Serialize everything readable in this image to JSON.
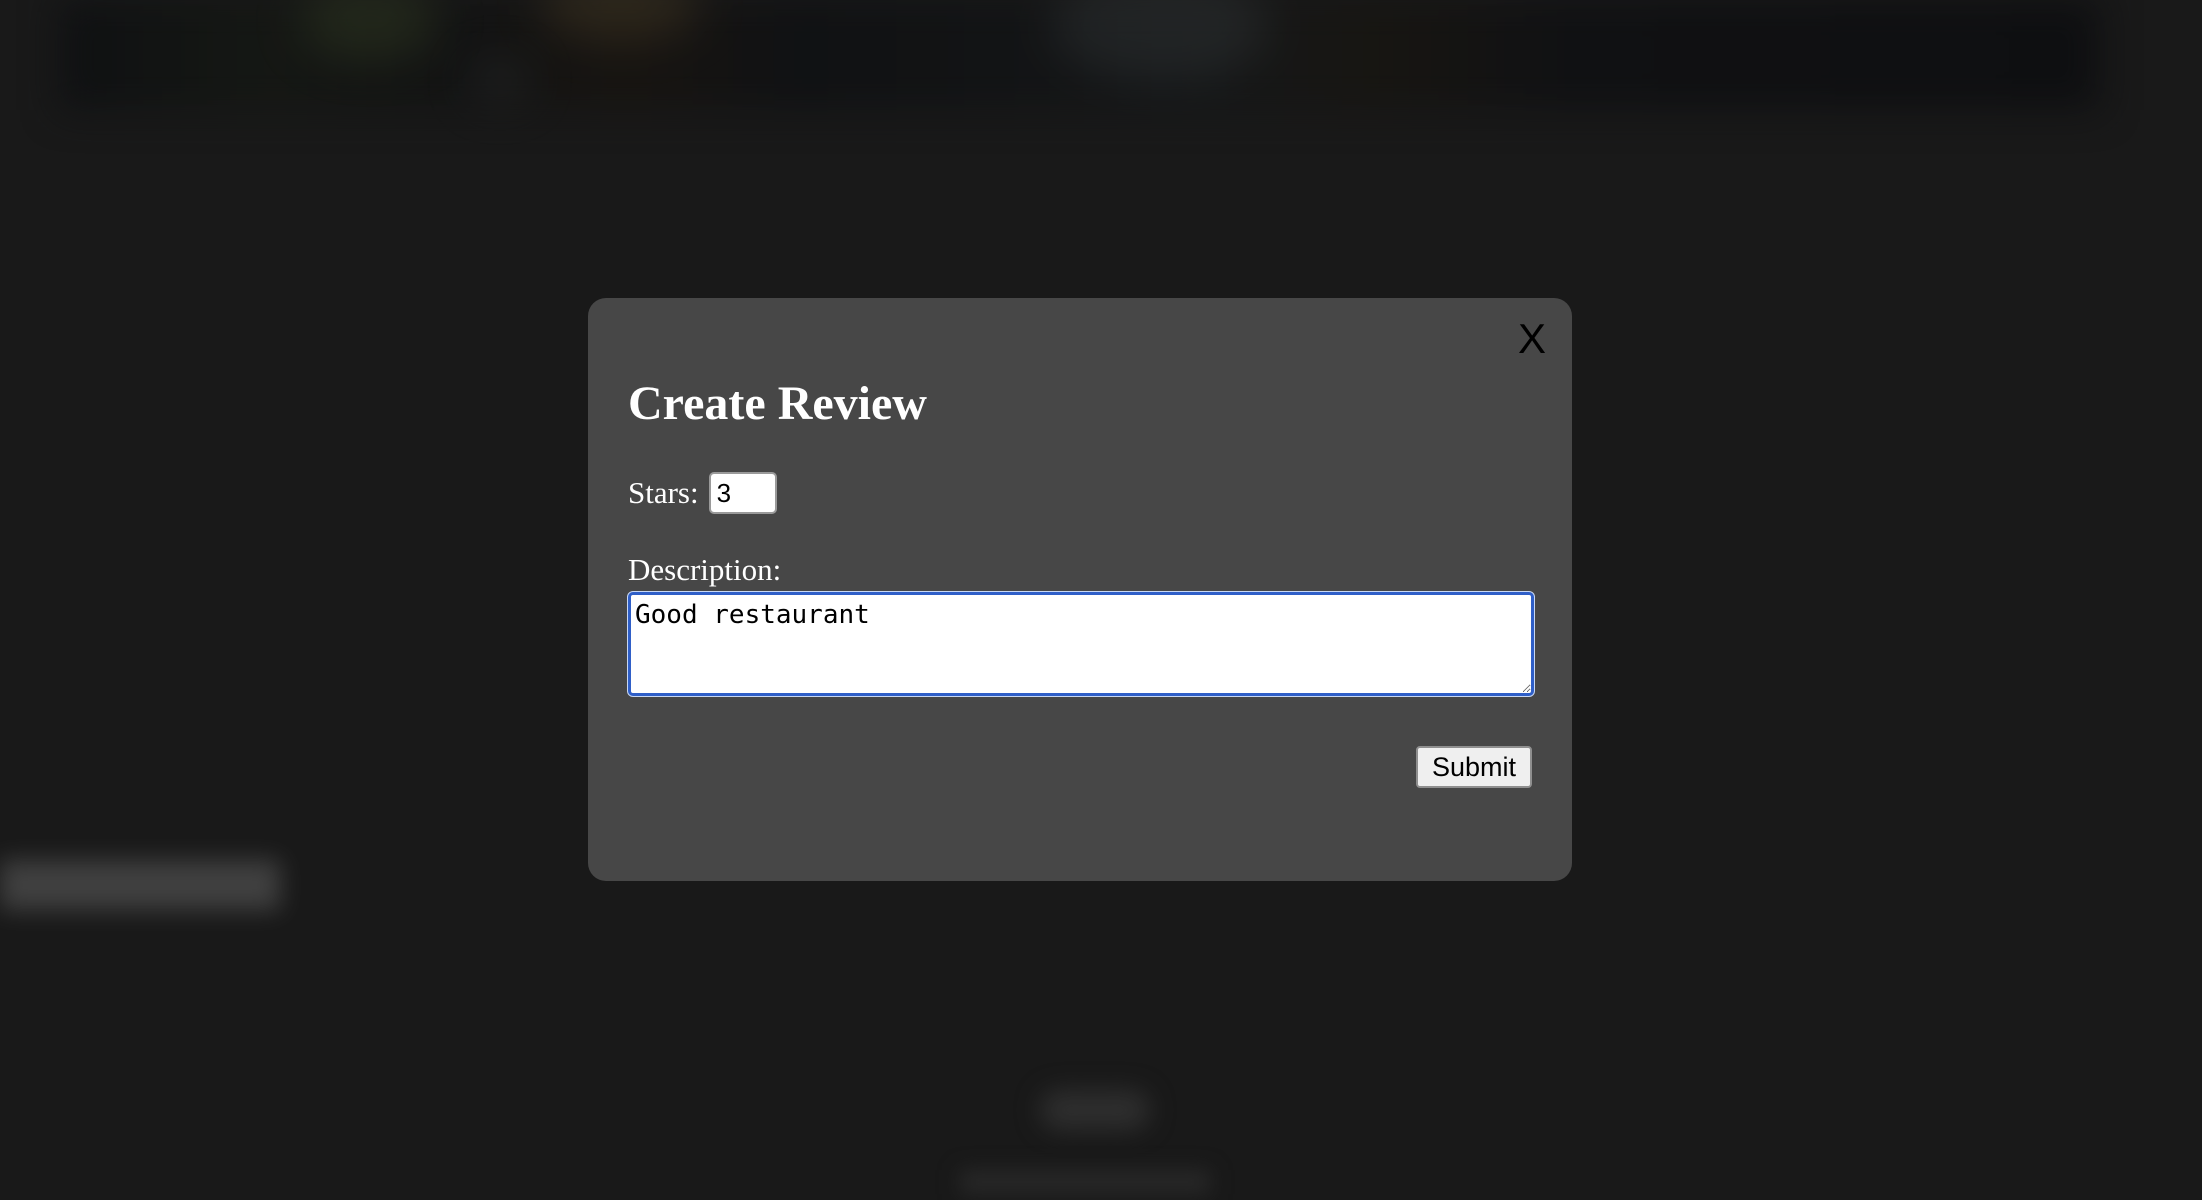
{
  "modal": {
    "close_label": "X",
    "title": "Create Review",
    "stars": {
      "label": "Stars:",
      "value": "3"
    },
    "description": {
      "label": "Description:",
      "value": "Good restaurant"
    },
    "submit_label": "Submit"
  },
  "colors": {
    "modal_bg": "#474747",
    "page_bg": "#1c1c1c",
    "focus_border": "#2f5fc8"
  }
}
